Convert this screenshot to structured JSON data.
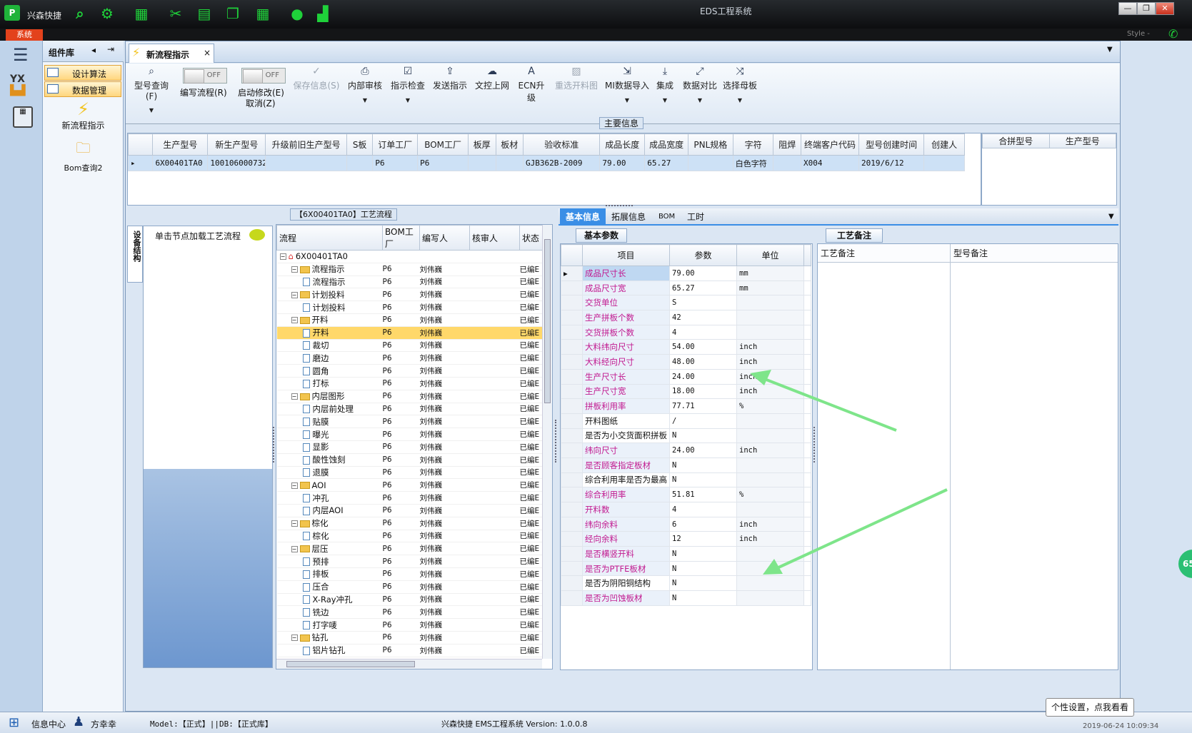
{
  "app": {
    "brand": "兴森快捷",
    "window_title": "EDS工程系统",
    "system_tab": "系统",
    "style_label": "Style -",
    "minimize": "—",
    "restore": "❐",
    "close": "✕"
  },
  "library": {
    "title": "组件库",
    "items": [
      "设计算法",
      "数据管理"
    ],
    "new_flow": "新流程指示",
    "bom_query": "Bom查询2"
  },
  "doc_tab": {
    "label": "新流程指示",
    "close": "×"
  },
  "toolbar": {
    "query": "型号查询(F)",
    "write_flow": "编写流程(R)",
    "auto_modify": "启动修改(E)",
    "cancel": "取消(Z)",
    "toggle_off": "OFF",
    "save_info": "保存信息(S)",
    "internal_review": "内部审核",
    "check": "指示检查",
    "send": "发送指示",
    "upload": "文控上网",
    "ecn": "ECN升级",
    "reselect_drawing": "重选开料图",
    "mi_import": "MI数据导入",
    "integrate": "集成",
    "compare": "数据对比",
    "select_master": "选择母板"
  },
  "main_info": {
    "label": "主要信息",
    "columns": [
      "生产型号",
      "新生产型号",
      "升级前旧生产型号",
      "S板",
      "订单工厂",
      "BOM工厂",
      "板厚",
      "板材",
      "验收标准",
      "成品长度",
      "成品宽度",
      "PNL规格",
      "字符",
      "阻焊",
      "终端客户代码",
      "型号创建时间",
      "创建人"
    ],
    "row": [
      "6X00401TA0",
      "100106000732T1",
      "",
      "",
      "P6",
      "P6",
      "",
      "",
      "GJB362B-2009",
      "79.00",
      "65.27",
      "",
      "白色字符",
      "",
      "X004",
      "2019/6/12",
      ""
    ],
    "side_columns": [
      "合拼型号",
      "生产型号"
    ]
  },
  "flow": {
    "title": "【6X00401TA0】工艺流程",
    "hint": "单击节点加载工艺流程",
    "side_tab": "设备结构",
    "columns": [
      "流程",
      "BOM工厂",
      "编写人",
      "核审人",
      "状态"
    ],
    "rows": [
      {
        "lvl": 0,
        "name": "6X00401TA0",
        "type": "home",
        "factory": "",
        "writer": "",
        "status": ""
      },
      {
        "lvl": 1,
        "name": "流程指示",
        "type": "folder",
        "factory": "P6",
        "writer": "刘伟巍",
        "status": "已编E"
      },
      {
        "lvl": 2,
        "name": "流程指示",
        "type": "file",
        "factory": "P6",
        "writer": "刘伟巍",
        "status": "已编E"
      },
      {
        "lvl": 1,
        "name": "计划投料",
        "type": "folder",
        "factory": "P6",
        "writer": "刘伟巍",
        "status": "已编E"
      },
      {
        "lvl": 2,
        "name": "计划投料",
        "type": "file",
        "factory": "P6",
        "writer": "刘伟巍",
        "status": "已编E"
      },
      {
        "lvl": 1,
        "name": "开料",
        "type": "folder",
        "factory": "P6",
        "writer": "刘伟巍",
        "status": "已编E"
      },
      {
        "lvl": 2,
        "name": "开料",
        "type": "file",
        "factory": "P6",
        "writer": "刘伟巍",
        "status": "已编E",
        "sel": true
      },
      {
        "lvl": 2,
        "name": "裁切",
        "type": "file",
        "factory": "P6",
        "writer": "刘伟巍",
        "status": "已编E"
      },
      {
        "lvl": 2,
        "name": "磨边",
        "type": "file",
        "factory": "P6",
        "writer": "刘伟巍",
        "status": "已编E"
      },
      {
        "lvl": 2,
        "name": "圆角",
        "type": "file",
        "factory": "P6",
        "writer": "刘伟巍",
        "status": "已编E"
      },
      {
        "lvl": 2,
        "name": "打标",
        "type": "file",
        "factory": "P6",
        "writer": "刘伟巍",
        "status": "已编E"
      },
      {
        "lvl": 1,
        "name": "内层图形",
        "type": "folder",
        "factory": "P6",
        "writer": "刘伟巍",
        "status": "已编E"
      },
      {
        "lvl": 2,
        "name": "内层前处理",
        "type": "file",
        "factory": "P6",
        "writer": "刘伟巍",
        "status": "已编E"
      },
      {
        "lvl": 2,
        "name": "贴膜",
        "type": "file",
        "factory": "P6",
        "writer": "刘伟巍",
        "status": "已编E"
      },
      {
        "lvl": 2,
        "name": "曝光",
        "type": "file",
        "factory": "P6",
        "writer": "刘伟巍",
        "status": "已编E"
      },
      {
        "lvl": 2,
        "name": "显影",
        "type": "file",
        "factory": "P6",
        "writer": "刘伟巍",
        "status": "已编E"
      },
      {
        "lvl": 2,
        "name": "酸性蚀刻",
        "type": "file",
        "factory": "P6",
        "writer": "刘伟巍",
        "status": "已编E"
      },
      {
        "lvl": 2,
        "name": "退膜",
        "type": "file",
        "factory": "P6",
        "writer": "刘伟巍",
        "status": "已编E"
      },
      {
        "lvl": 1,
        "name": "AOI",
        "type": "folder",
        "factory": "P6",
        "writer": "刘伟巍",
        "status": "已编E"
      },
      {
        "lvl": 2,
        "name": "冲孔",
        "type": "file",
        "factory": "P6",
        "writer": "刘伟巍",
        "status": "已编E"
      },
      {
        "lvl": 2,
        "name": "内层AOI",
        "type": "file",
        "factory": "P6",
        "writer": "刘伟巍",
        "status": "已编E"
      },
      {
        "lvl": 1,
        "name": "棕化",
        "type": "folder",
        "factory": "P6",
        "writer": "刘伟巍",
        "status": "已编E"
      },
      {
        "lvl": 2,
        "name": "棕化",
        "type": "file",
        "factory": "P6",
        "writer": "刘伟巍",
        "status": "已编E"
      },
      {
        "lvl": 1,
        "name": "层压",
        "type": "folder",
        "factory": "P6",
        "writer": "刘伟巍",
        "status": "已编E"
      },
      {
        "lvl": 2,
        "name": "预排",
        "type": "file",
        "factory": "P6",
        "writer": "刘伟巍",
        "status": "已编E"
      },
      {
        "lvl": 2,
        "name": "排板",
        "type": "file",
        "factory": "P6",
        "writer": "刘伟巍",
        "status": "已编E"
      },
      {
        "lvl": 2,
        "name": "压合",
        "type": "file",
        "factory": "P6",
        "writer": "刘伟巍",
        "status": "已编E"
      },
      {
        "lvl": 2,
        "name": "X-Ray冲孔",
        "type": "file",
        "factory": "P6",
        "writer": "刘伟巍",
        "status": "已编E"
      },
      {
        "lvl": 2,
        "name": "铣边",
        "type": "file",
        "factory": "P6",
        "writer": "刘伟巍",
        "status": "已编E"
      },
      {
        "lvl": 2,
        "name": "打字唛",
        "type": "file",
        "factory": "P6",
        "writer": "刘伟巍",
        "status": "已编E"
      },
      {
        "lvl": 1,
        "name": "钻孔",
        "type": "folder",
        "factory": "P6",
        "writer": "刘伟巍",
        "status": "已编E"
      },
      {
        "lvl": 2,
        "name": "铝片钻孔",
        "type": "file",
        "factory": "P6",
        "writer": "刘伟巍",
        "status": "已编E"
      },
      {
        "lvl": 2,
        "name": "钻孔",
        "type": "file",
        "factory": "P6",
        "writer": "刘伟巍",
        "status": "已编E"
      }
    ]
  },
  "detail_tabs": [
    "基本信息",
    "拓展信息",
    "BOM",
    "工时"
  ],
  "basic_params": {
    "title": "基本参数",
    "columns": [
      "项目",
      "参数",
      "单位"
    ],
    "rows": [
      {
        "item": "成品尺寸长",
        "value": "79.00",
        "unit": "mm",
        "m": true
      },
      {
        "item": "成品尺寸宽",
        "value": "65.27",
        "unit": "mm",
        "m": true
      },
      {
        "item": "交货单位",
        "value": "S",
        "unit": "",
        "m": true
      },
      {
        "item": "生产拼板个数",
        "value": "42",
        "unit": "",
        "m": true
      },
      {
        "item": "交货拼板个数",
        "value": "4",
        "unit": "",
        "m": true
      },
      {
        "item": "大料纬向尺寸",
        "value": "54.00",
        "unit": "inch",
        "m": true
      },
      {
        "item": "大料经向尺寸",
        "value": "48.00",
        "unit": "inch",
        "m": true
      },
      {
        "item": "生产尺寸长",
        "value": "24.00",
        "unit": "inch",
        "m": true
      },
      {
        "item": "生产尺寸宽",
        "value": "18.00",
        "unit": "inch",
        "m": true
      },
      {
        "item": "拼板利用率",
        "value": "77.71",
        "unit": "%",
        "m": true
      },
      {
        "item": "开料图纸",
        "value": "/",
        "unit": "",
        "m": false
      },
      {
        "item": "是否为小交货面积拼板",
        "value": "N",
        "unit": "",
        "m": false
      },
      {
        "item": "纬向尺寸",
        "value": "24.00",
        "unit": "inch",
        "m": true
      },
      {
        "item": "是否顾客指定板材",
        "value": "N",
        "unit": "",
        "m": true
      },
      {
        "item": "综合利用率是否为最高",
        "value": "N",
        "unit": "",
        "m": false
      },
      {
        "item": "综合利用率",
        "value": "51.81",
        "unit": "%",
        "m": true
      },
      {
        "item": "开料数",
        "value": "4",
        "unit": "",
        "m": true
      },
      {
        "item": "纬向余料",
        "value": "6",
        "unit": "inch",
        "m": true
      },
      {
        "item": "经向余料",
        "value": "12",
        "unit": "inch",
        "m": true
      },
      {
        "item": "是否横竖开料",
        "value": "N",
        "unit": "",
        "m": true
      },
      {
        "item": "是否为PTFE板材",
        "value": "N",
        "unit": "",
        "m": true
      },
      {
        "item": "是否为阴阳铜结构",
        "value": "N",
        "unit": "",
        "m": false
      },
      {
        "item": "是否为凹蚀板材",
        "value": "N",
        "unit": "",
        "m": true
      }
    ]
  },
  "process_notes": {
    "title": "工艺备注",
    "columns": [
      "工艺备注",
      "型号备注"
    ]
  },
  "tooltip": "个性设置，点我看看",
  "float_badge": "65",
  "status": {
    "info_center": "信息中心",
    "user": "方幸幸",
    "model": "Model:【正式】||DB:【正式库】",
    "version": "兴森快捷 EMS工程系统 Version: 1.0.0.8",
    "clock": "2019-06-24 10:09:34"
  },
  "colors": {
    "accent": "#3a8ee6",
    "selection": "#ffd86a",
    "magenta": "#c1188f",
    "arrow": "#7ee58a"
  }
}
